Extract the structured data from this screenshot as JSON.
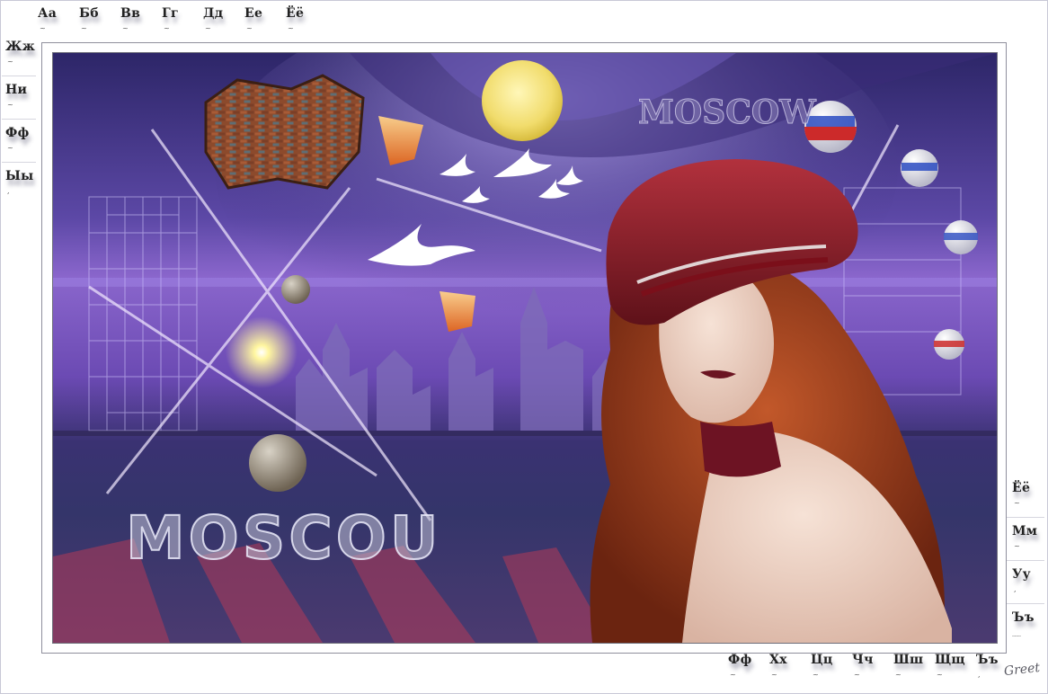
{
  "letters": {
    "top": [
      "Аа",
      "Бб",
      "Вв",
      "Гг",
      "Дд",
      "Ее",
      "Ёё"
    ],
    "left": [
      "Жж",
      "Ни",
      "Фф",
      "Ыы"
    ],
    "right": [
      "Ёё",
      "Мм",
      "Уу",
      "Ъъ"
    ],
    "bottom": [
      "Фф",
      "Хх",
      "Цц",
      "Чч",
      "Шш",
      "Щщ",
      "Ъъ"
    ]
  },
  "artwork": {
    "city_text": "MOSCOU",
    "sky_text": "MOSCOW"
  },
  "signature": "Greet",
  "colors": {
    "frame": "#8f8f9c",
    "sky_top": "#2c2466",
    "purple_band": "#7a4fc0",
    "cap_red": "#8d1f2a",
    "hair": "#9b3d1c",
    "moon": "#f3e47a"
  }
}
